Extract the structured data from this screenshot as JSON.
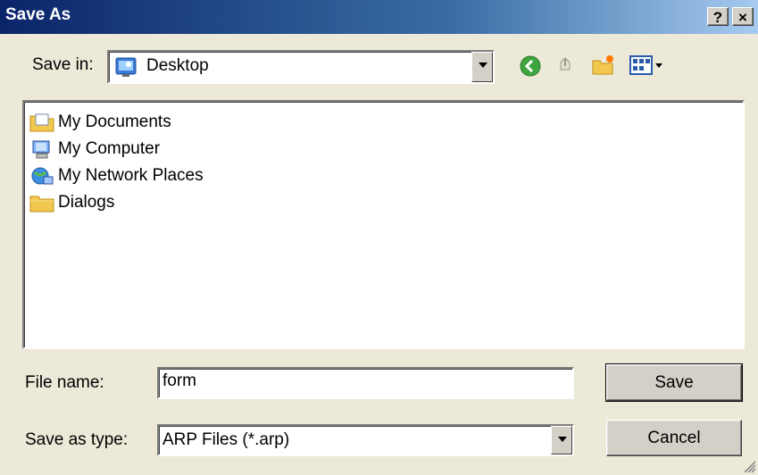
{
  "window": {
    "title": "Save As",
    "help_label": "?",
    "close_label": "×"
  },
  "toolbar": {
    "save_in_label": "Save in:",
    "save_in_value": "Desktop"
  },
  "files": [
    {
      "name": "My Documents",
      "icon": "my-documents-icon"
    },
    {
      "name": "My Computer",
      "icon": "my-computer-icon"
    },
    {
      "name": "My Network Places",
      "icon": "network-places-icon"
    },
    {
      "name": "Dialogs",
      "icon": "folder-icon"
    }
  ],
  "form": {
    "file_name_label": "File name:",
    "file_name_value": "form",
    "save_type_label": "Save as type:",
    "save_type_value": "ARP Files (*.arp)"
  },
  "buttons": {
    "save": "Save",
    "cancel": "Cancel"
  },
  "colors": {
    "title_bar_start": "#0a246a",
    "title_bar_end": "#a6caf0",
    "face": "#ece9d8"
  }
}
